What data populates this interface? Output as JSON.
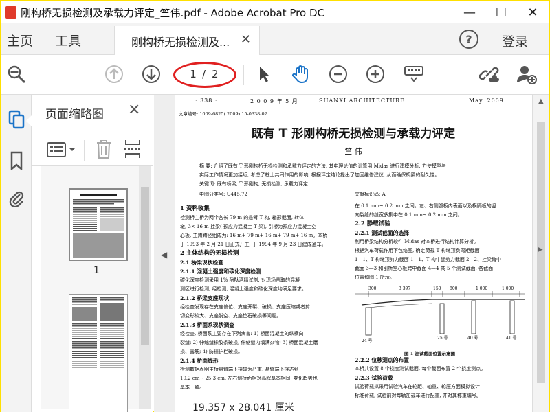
{
  "window": {
    "title": "刚构桥无损检测及承载力评定_竺伟.pdf - Adobe Acrobat Pro DC",
    "minimize": "—",
    "maximize": "☐",
    "close": "✕"
  },
  "menu": {
    "home": "主页",
    "tools": "工具",
    "tab_label": "刚构桥无损检测及...",
    "tab_close": "✕",
    "help": "?",
    "login": "登录"
  },
  "toolbar": {
    "current_page": "1",
    "separator": "/",
    "total_pages": "2",
    "icons": [
      "search-zoom-icon",
      "page-up-icon",
      "page-down-icon",
      "select-cursor-icon",
      "hand-tool-icon",
      "zoom-out-icon",
      "zoom-in-icon",
      "keyboard-icon",
      "link-cloud-icon",
      "add-user-icon"
    ]
  },
  "thumbnails": {
    "header": "页面缩略图",
    "close": "✕",
    "pages": [
      {
        "number": "1"
      },
      {
        "number": ""
      }
    ]
  },
  "document": {
    "page_no": "· 338 ·",
    "header_date": "2 0 0 9 年 5 月",
    "header_journal": "SHANXI   ARCHITECTURE",
    "header_right": "May.   2009",
    "doc_id": "文章编号: 1009-6825( 2009) 15-0338-02",
    "title": "既有 T 形刚构桥无损检测与承载力评定",
    "author": "竺    伟",
    "abstract": [
      "摘    要: 介绍了既有 T 形刚构桥无损检测和承载力评定的方法, 其中理论值的计算用 Midas 进行建模分析, 力使模型与",
      "实际工作情况更加接近, 考虑了桩土共同作用的影响, 根据评定结论提出了加固维修建议, 从而确保桥梁的耐久性。",
      "关键词: 既有桥梁, T 形刚构, 无损检测, 承载力评定"
    ],
    "clc": "中图分类号: U445.72",
    "doc_code": "文献标识码: A",
    "left_col": [
      {
        "cls": "h1",
        "text": "1   资料收集"
      },
      {
        "cls": "",
        "text": "    检测桥主桥为两个各长 79 m 的悬臂 T 构, 箱形截面, 转体"
      },
      {
        "cls": "",
        "text": "墩, 3× 16 m 挂梁( 预应力混凝土 T 梁), 引桥为预应力混凝土空"
      },
      {
        "cls": "",
        "text": "心板, 主跨跨径组成为: 16 m+ 79 m+ 16 m+ 79 m+ 16 m。本桥"
      },
      {
        "cls": "",
        "text": "于 1993 年 2 月 21 日正式开工, 于 1994 年 9 月 23 日建成通车。"
      },
      {
        "cls": "h1",
        "text": "2   主体结构的无损检测"
      },
      {
        "cls": "h2",
        "text": "2.1    桥梁现状检查"
      },
      {
        "cls": "h2",
        "text": "2.1.1    混凝土强度和碳化深度检测"
      },
      {
        "cls": "",
        "text": "    碳化深度检测采用 1% 酚酞酒精试剂, 对现场凿取的混凝土"
      },
      {
        "cls": "",
        "text": "测区进行检测, 经检测, 混凝土强度和碳化深度均满足要求。"
      },
      {
        "cls": "h2",
        "text": "2.1.2    桥梁支座现状"
      },
      {
        "cls": "",
        "text": "    经检查发现存在支座偏位、支座开裂、破损、支座压缩或者剪"
      },
      {
        "cls": "",
        "text": "切变形较大、支座脱空、支座垫石破损等问题。"
      },
      {
        "cls": "h2",
        "text": "2.1.3    桥面系现状调查"
      },
      {
        "cls": "",
        "text": "    经检查, 桥面系主要存在下列病害: 1) 桥面混凝土的纵横向"
      },
      {
        "cls": "",
        "text": "裂缝; 2) 伸缩缝橡胶条破损, 伸缩缝内填满杂物; 3) 桥面混凝土磨"
      },
      {
        "cls": "",
        "text": "损、露筋; 4) 防撞护栏破损。"
      },
      {
        "cls": "h2",
        "text": "2.1.4    桥面线形"
      },
      {
        "cls": "",
        "text": "    检测数据表明主桥悬臂端下挠较为严重, 悬臂端下挠达到"
      },
      {
        "cls": "",
        "text": "10.2 cm~ 25.3 cm, 左右侧桥面相对高程基本相同, 变化趋势也"
      },
      {
        "cls": "",
        "text": "基本一致。"
      }
    ],
    "right_col_top": [
      {
        "cls": "",
        "text": "在 0.1 mm~ 0.2 mm 之间。左、右侧腹板内表面以及横隔板的竖"
      },
      {
        "cls": "",
        "text": "向裂缝的缝宽多集中在 0.1 mm~ 0.2 mm 之间。"
      },
      {
        "cls": "h1",
        "text": "2.2    静载试验"
      },
      {
        "cls": "h2",
        "text": "2.2.1    测试截面的选择"
      },
      {
        "cls": "",
        "text": "    利用桥梁结构分析软件 Midas 对本桥进行结构计算分析。"
      },
      {
        "cls": "",
        "text": "根据汽车荷载作用下包络图, 确定荷载 T 构墩顶负弯矩截面"
      },
      {
        "cls": "",
        "text": "1—1、T 构墩顶剪力截面 1—1、T 构牛腿剪力截面 2—2、挂梁跨中"
      },
      {
        "cls": "",
        "text": "截面 3—3 和引桥空心板跨中截面 4—4 共 5 个测试截面, 各截面"
      },
      {
        "cls": "",
        "text": "位置如图 1 所示。"
      }
    ],
    "figure": {
      "dims": [
        "300",
        "3 397",
        "150",
        "800",
        "1 000",
        "1 000"
      ],
      "labels": [
        "24 号",
        "25 号",
        "40 号",
        "41 号"
      ],
      "caption": "图 1    测试截面位置示意图"
    },
    "right_col_bottom": [
      {
        "cls": "h2",
        "text": "2.2.2    位移测点的布置"
      },
      {
        "cls": "",
        "text": "    本桥共设置 8 个挠度测试截面, 每个截面布置 2 个挠度测点。"
      },
      {
        "cls": "h2",
        "text": "2.2.3    试验荷载"
      },
      {
        "cls": "",
        "text": "    试验荷载拟采用试验汽车在轮距、轴重、轮压方面模拟设计"
      },
      {
        "cls": "",
        "text": "标准荷载, 试验前对每辆加载车进行配重, 并对其称重编号。"
      }
    ]
  },
  "status": {
    "page_size": "19.357 x 28.041 厘米"
  },
  "colors": {
    "accent_blue": "#1a73c8",
    "highlight_red": "#e02020",
    "border_yellow": "#ffe000"
  }
}
